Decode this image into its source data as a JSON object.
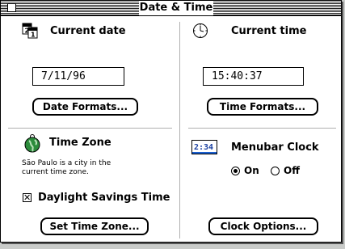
{
  "window": {
    "title": "Date & Time"
  },
  "date": {
    "header": "Current date",
    "value": "7/11/96",
    "formats_button": "Date Formats..."
  },
  "time": {
    "header": "Current time",
    "value": "15:40:37",
    "formats_button": "Time Formats..."
  },
  "timezone": {
    "header": "Time Zone",
    "description_line1": "São Paulo is a city in the",
    "description_line2": "current time zone.",
    "dst_label": "Daylight Savings Time",
    "dst_checked": true,
    "set_button": "Set Time Zone..."
  },
  "menubar_clock": {
    "header": "Menubar Clock",
    "icon_text": "2:34",
    "on_label": "On",
    "off_label": "Off",
    "selected": "On",
    "options_button": "Clock Options..."
  }
}
